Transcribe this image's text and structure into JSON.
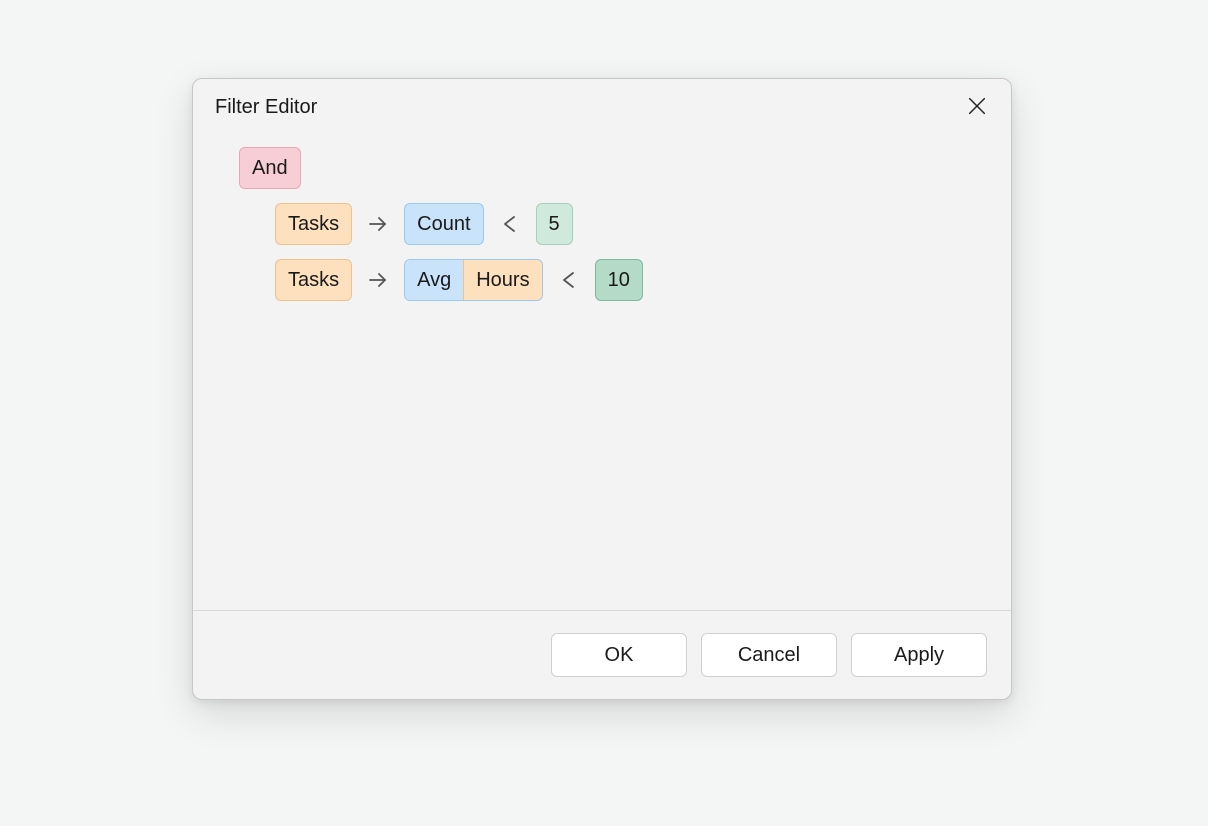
{
  "dialog": {
    "title": "Filter Editor",
    "buttons": {
      "ok": "OK",
      "cancel": "Cancel",
      "apply": "Apply"
    }
  },
  "filter": {
    "group_op": "And",
    "conditions": [
      {
        "source": "Tasks",
        "aggregate": "Count",
        "field": "",
        "operator": "<",
        "value": "5"
      },
      {
        "source": "Tasks",
        "aggregate": "Avg",
        "field": "Hours",
        "operator": "<",
        "value": "10"
      }
    ]
  },
  "colors": {
    "bg": "#f4f5f5",
    "dialog_bg": "#f3f3f3",
    "token_group": "#f7cdd6",
    "token_source": "#fde0be",
    "token_aggregate": "#c9e3fb",
    "token_value": "#cfe9dc",
    "token_value_strong": "#b4dac8"
  }
}
